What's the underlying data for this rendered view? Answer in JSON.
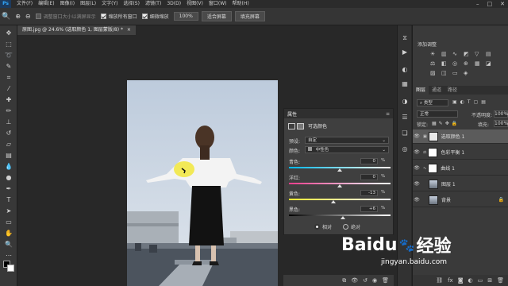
{
  "app": {
    "logo": "Ps"
  },
  "menu": [
    "文件(F)",
    "编辑(E)",
    "图像(I)",
    "图层(L)",
    "文字(Y)",
    "选择(S)",
    "滤镜(T)",
    "3D(D)",
    "视图(V)",
    "窗口(W)",
    "帮助(H)"
  ],
  "window_controls": [
    "–",
    "□",
    "✕"
  ],
  "options_bar": {
    "resize_windows_label": "调整窗口大小以满屏显示",
    "resize_windows_checked": false,
    "zoom_all_windows_label": "缩放所有窗口",
    "zoom_all_windows_checked": true,
    "scrubby_zoom_label": "细微缩放",
    "scrubby_zoom_checked": true,
    "zoom_level": "100%",
    "fit_screen_label": "适合屏幕",
    "fill_screen_label": "填充屏幕"
  },
  "document_tab": {
    "title": "原图.jpg @ 24.6% (选取颜色 1, 图层蒙版/8) *",
    "close": "×"
  },
  "properties": {
    "title": "属性",
    "adjustment_name": "可选颜色",
    "preset_label": "预设:",
    "preset_value": "自定",
    "colors_label": "颜色:",
    "colors_value": "中性色",
    "sliders": [
      {
        "label": "青色:",
        "value": "0",
        "unit": "%",
        "level": 0
      },
      {
        "label": "洋红:",
        "value": "0",
        "unit": "%",
        "level": 0
      },
      {
        "label": "黄色:",
        "value": "-13",
        "unit": "%",
        "level": -13
      },
      {
        "label": "黑色:",
        "value": "+6",
        "unit": "%",
        "level": 6
      }
    ],
    "method_relative": "相对",
    "method_absolute": "绝对",
    "method_selected": "relative"
  },
  "adjustments_panel": {
    "title": "添加调整"
  },
  "layers_panel": {
    "tabs": [
      "图层",
      "通道",
      "路径"
    ],
    "filter_label": "类型",
    "blend_mode": "正常",
    "opacity_label": "不透明度:",
    "opacity_value": "100%",
    "lock_label": "锁定:",
    "fill_label": "填充:",
    "fill_value": "100%",
    "layers": [
      {
        "name": "选取颜色 1",
        "selected": true
      },
      {
        "name": "色彩平衡 1",
        "selected": false
      },
      {
        "name": "曲线 1",
        "selected": false
      },
      {
        "name": "图层 1",
        "selected": false
      },
      {
        "name": "背景",
        "selected": false
      }
    ]
  },
  "watermark": {
    "brand": "Baidu",
    "brand_cn": "经验",
    "url": "jingyan.baidu.com"
  },
  "colors": {
    "accent": "#31a8ff",
    "selected_layer": "#5b5b5b",
    "highlight_yellow": "#f1e63a"
  }
}
